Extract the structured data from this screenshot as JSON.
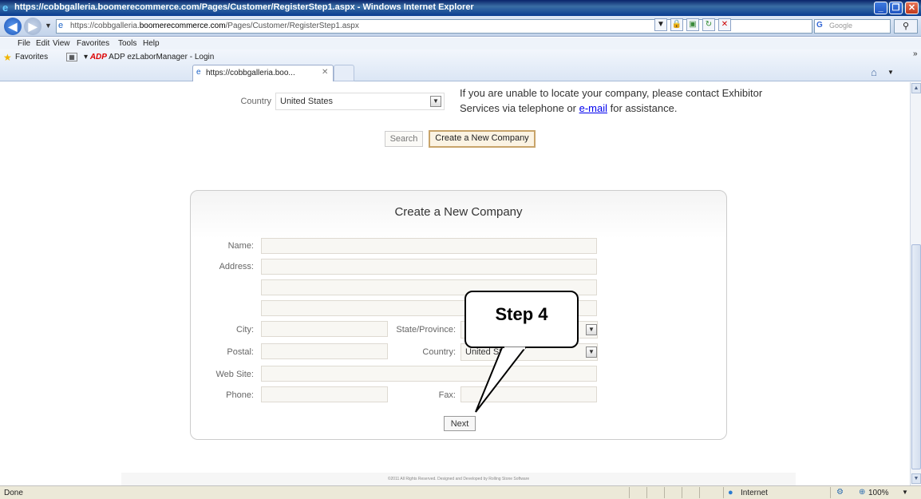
{
  "window": {
    "title": "https://cobbgalleria.boomerecommerce.com/Pages/Customer/RegisterStep1.aspx - Windows Internet Explorer"
  },
  "addressbar": {
    "url_prefix": "https://cobbgalleria.",
    "url_domain": "boomerecommerce.com",
    "url_path": "/Pages/Customer/RegisterStep1.aspx",
    "search_placeholder": "Google"
  },
  "menu": {
    "items": [
      "File",
      "Edit",
      "View",
      "Favorites",
      "Tools",
      "Help"
    ]
  },
  "favorites": {
    "label": "Favorites",
    "adp_prefix": "ADP",
    "adp_link": "ADP ezLaborManager - Login",
    "tab_title": "https://cobbgalleria.boo..."
  },
  "lookup": {
    "country_label": "Country",
    "country_value": "United States",
    "info_prefix": "If you are unable to locate your company, please contact Exhibitor Services via telephone or ",
    "info_link": "e-mail",
    "info_suffix": " for assistance.",
    "search_label": "Search",
    "create_label": "Create a New Company"
  },
  "form": {
    "title": "Create a New Company",
    "name_label": "Name:",
    "address_label": "Address:",
    "city_label": "City:",
    "state_label": "State/Province:",
    "postal_label": "Postal:",
    "country_label": "Country:",
    "country_value": "United States",
    "website_label": "Web Site:",
    "phone_label": "Phone:",
    "fax_label": "Fax:",
    "next_label": "Next"
  },
  "callout": {
    "text": "Step 4"
  },
  "footer": {
    "text": "©2011 All Rights Reserved.   Designed and Developed by Rolling Stone Software"
  },
  "status": {
    "done": "Done",
    "zone": "Internet",
    "zoom": "100%"
  },
  "colors": {
    "accent_border": "#c8a46a",
    "link": "#0000ee"
  }
}
